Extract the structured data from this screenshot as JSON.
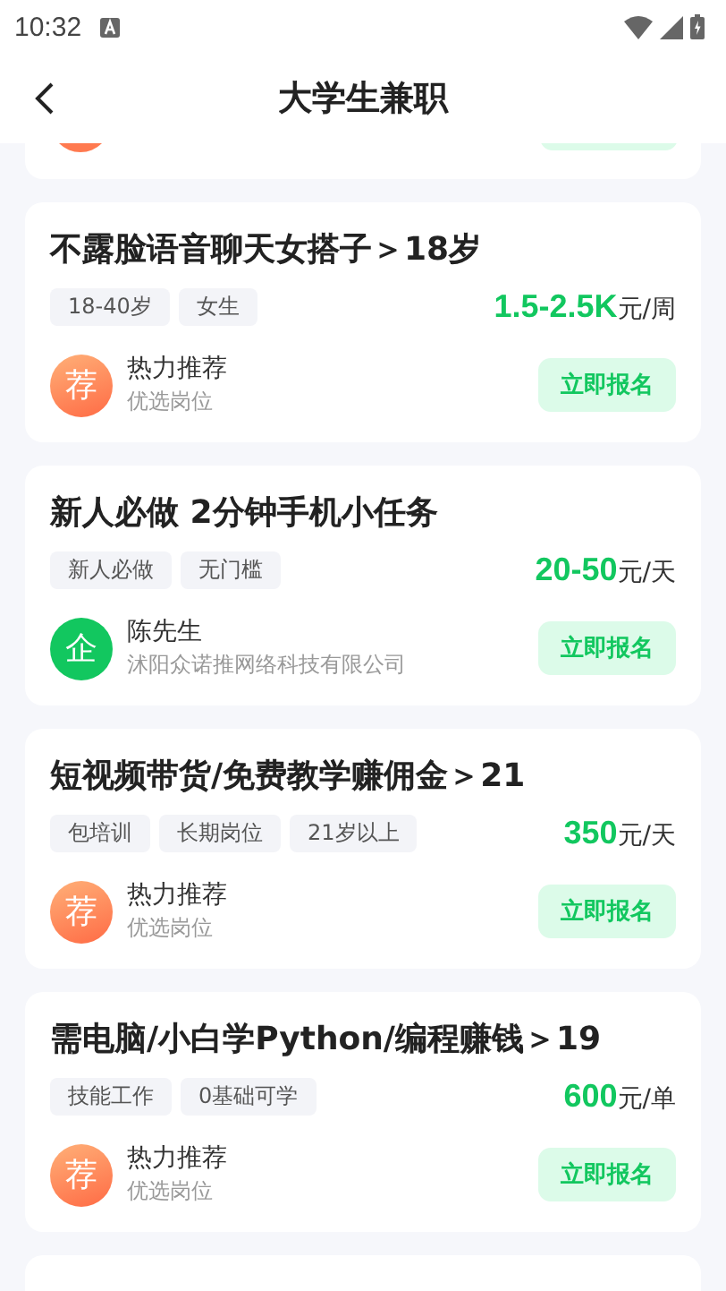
{
  "status_bar": {
    "time": "10:32"
  },
  "header": {
    "title": "大学生兼职"
  },
  "jobs": [
    {
      "title": "不露脸语音聊天女搭子＞18岁",
      "tags": [
        "18-40岁",
        "女生"
      ],
      "pay": "1.5-2.5K",
      "unit": "元/周",
      "poster": {
        "kind": "recommend",
        "avatar": "荐",
        "name": "热力推荐",
        "subtitle": "优选岗位"
      },
      "action": "立即报名"
    },
    {
      "title": "新人必做 2分钟手机小任务",
      "tags": [
        "新人必做",
        "无门槛"
      ],
      "pay": "20-50",
      "unit": "元/天",
      "poster": {
        "kind": "company",
        "avatar": "企",
        "name": "陈先生",
        "subtitle": "沭阳众诺推网络科技有限公司"
      },
      "action": "立即报名"
    },
    {
      "title": "短视频带货/免费教学赚佣金＞21",
      "tags": [
        "包培训",
        "长期岗位",
        "21岁以上"
      ],
      "pay": "350",
      "unit": "元/天",
      "poster": {
        "kind": "recommend",
        "avatar": "荐",
        "name": "热力推荐",
        "subtitle": "优选岗位"
      },
      "action": "立即报名"
    },
    {
      "title": "需电脑/小白学Python/编程赚钱＞19",
      "tags": [
        "技能工作",
        "0基础可学"
      ],
      "pay": "600",
      "unit": "元/单",
      "poster": {
        "kind": "recommend",
        "avatar": "荐",
        "name": "热力推荐",
        "subtitle": "优选岗位"
      },
      "action": "立即报名"
    }
  ]
}
